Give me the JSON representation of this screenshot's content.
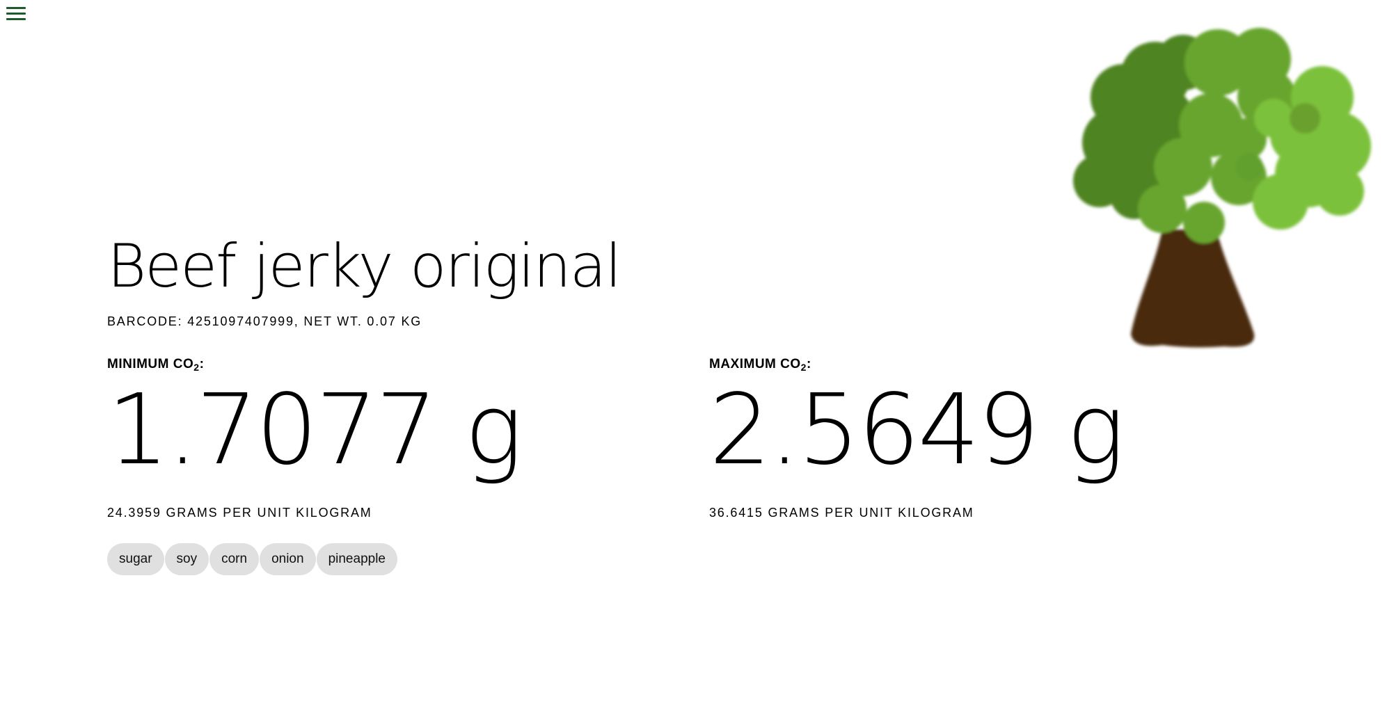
{
  "product": {
    "name": "Beef jerky original",
    "subtitle": "BARCODE: 4251097407999, NET WT. 0.07 KG"
  },
  "emissions": {
    "minimum": {
      "label_prefix": "MINIMUM CO",
      "label_sub": "2",
      "label_suffix": ":",
      "value": "1.7077 g",
      "rate": "24.3959 GRAMS PER UNIT KILOGRAM"
    },
    "maximum": {
      "label_prefix": "MAXIMUM CO",
      "label_sub": "2",
      "label_suffix": ":",
      "value": "2.5649 g",
      "rate": "36.6415 GRAMS PER UNIT KILOGRAM"
    }
  },
  "ingredients": [
    "sugar",
    "soy",
    "corn",
    "onion",
    "pineapple"
  ],
  "icons": {
    "menu": "hamburger-menu-icon",
    "tree": "tree-illustration"
  },
  "colors": {
    "menu_icon": "#1e5a2a",
    "tag_background": "#e0e0e0",
    "trunk": "#4a2a10",
    "foliage_dark": "#4f8424",
    "foliage_mid": "#68a52e",
    "foliage_light": "#7cc13a"
  }
}
